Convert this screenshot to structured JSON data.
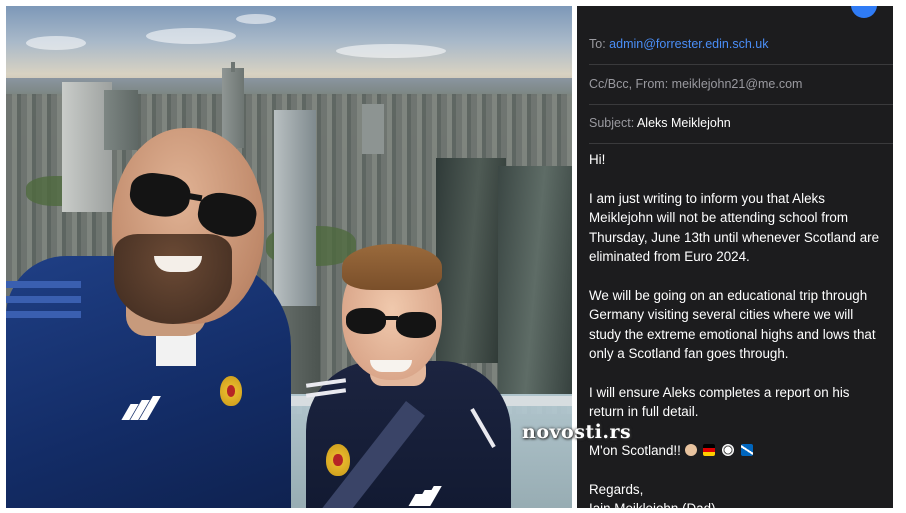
{
  "email": {
    "partial_top_text": "",
    "to_label": "To:",
    "to_value": "admin@forrester.edin.sch.uk",
    "ccbcc_label": "Cc/Bcc, From:",
    "from_value": "meiklejohn21@me.com",
    "subject_label": "Subject:",
    "subject_value": "Aleks Meiklejohn",
    "greeting": "Hi!",
    "para1": "I am just writing to inform you that Aleks Meiklejohn will not be attending school from Thursday, June 13th until whenever Scotland are eliminated from Euro 2024.",
    "para2": "We will be going on an educational trip through Germany visiting several cities where we will study the extreme emotional highs and lows that only a Scotland fan goes through.",
    "para3": "I will ensure Aleks completes a report on his return in full detail.",
    "motto": "M'on Scotland!!",
    "emoji_icons": [
      "fist-emoji",
      "germany-flag-emoji",
      "football-emoji",
      "scotland-flag-emoji"
    ],
    "closing": "Regards,",
    "signature_partial": "Iain Meiklejohn (Dad)"
  },
  "photo": {
    "description_icons": [
      "scotland-crest-icon",
      "adidas-logo-icon"
    ]
  },
  "watermark": "novosti.rs",
  "colors": {
    "email_bg": "#1c1c1e",
    "link": "#4a8ef7",
    "label": "#9a9aa0",
    "jacket": "#1f3f85"
  }
}
